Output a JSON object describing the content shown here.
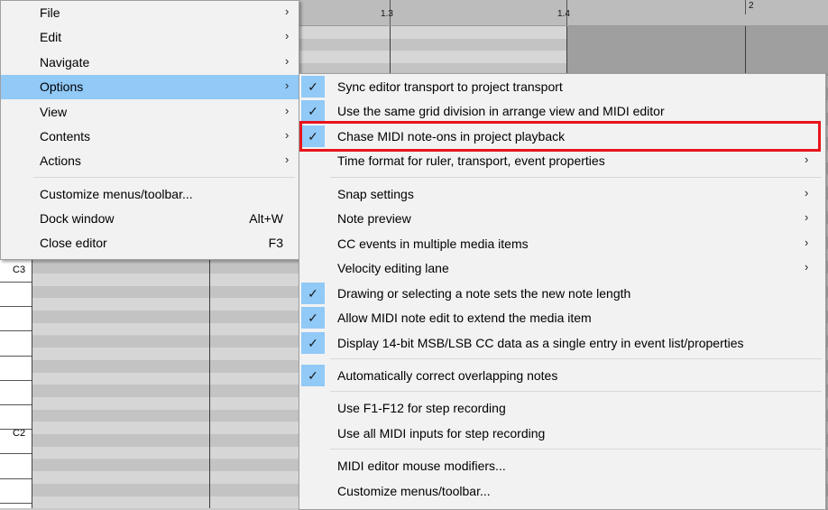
{
  "ruler": {
    "labels": [
      "1.3",
      "1.4",
      "2"
    ]
  },
  "piano": {
    "note_labels": [
      "C3",
      "C2"
    ]
  },
  "main_menu": {
    "items": [
      {
        "label": "File",
        "has_submenu": true
      },
      {
        "label": "Edit",
        "has_submenu": true
      },
      {
        "label": "Navigate",
        "has_submenu": true
      },
      {
        "label": "Options",
        "has_submenu": true,
        "highlighted": true
      },
      {
        "label": "View",
        "has_submenu": true
      },
      {
        "label": "Contents",
        "has_submenu": true
      },
      {
        "label": "Actions",
        "has_submenu": true
      },
      {
        "label": "Customize menus/toolbar..."
      },
      {
        "label": "Dock window",
        "shortcut": "Alt+W"
      },
      {
        "label": "Close editor",
        "shortcut": "F3"
      }
    ]
  },
  "options_menu": {
    "items": [
      {
        "label": "Sync editor transport to project transport",
        "checked": true
      },
      {
        "label": "Use the same grid division in arrange view and MIDI editor",
        "checked": true
      },
      {
        "label": "Chase MIDI note-ons in project playback",
        "checked": true,
        "annotated": true
      },
      {
        "label": "Time format for ruler, transport, event properties",
        "has_submenu": true
      },
      {
        "label": "Snap settings",
        "has_submenu": true
      },
      {
        "label": "Note preview",
        "has_submenu": true
      },
      {
        "label": "CC events in multiple media items",
        "has_submenu": true
      },
      {
        "label": "Velocity editing lane",
        "has_submenu": true
      },
      {
        "label": "Drawing or selecting a note sets the new note length",
        "checked": true
      },
      {
        "label": "Allow MIDI note edit to extend the media item",
        "checked": true
      },
      {
        "label": "Display 14-bit MSB/LSB CC data as a single entry in event list/properties",
        "checked": true
      },
      {
        "label": "Automatically correct overlapping notes",
        "checked": true
      },
      {
        "label": "Use F1-F12 for step recording"
      },
      {
        "label": "Use all MIDI inputs for step recording"
      },
      {
        "label": "MIDI editor mouse modifiers..."
      },
      {
        "label": "Customize menus/toolbar..."
      }
    ]
  },
  "glyphs": {
    "arrow": "›",
    "check": "✓"
  },
  "colors": {
    "highlight": "#91c9f7",
    "annotation": "#e8141c"
  }
}
